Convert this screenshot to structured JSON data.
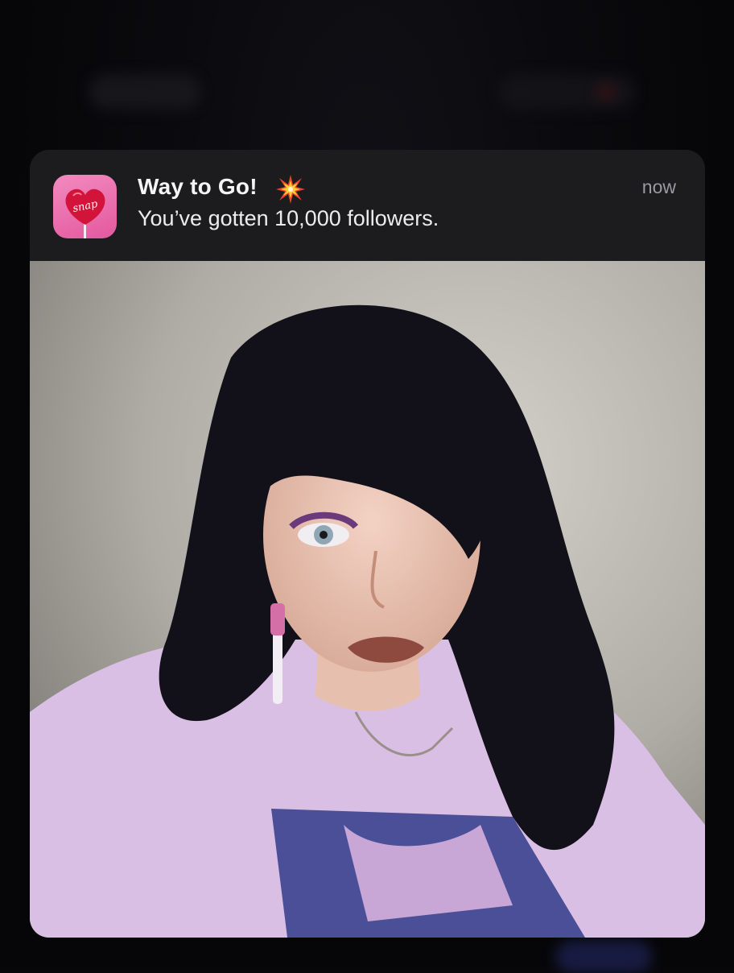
{
  "notification": {
    "app_icon": "snap-lollipop-heart-icon",
    "app_icon_text": "snap",
    "title": "Way to Go!",
    "title_emoji": "collision-emoji",
    "message": "You’ve gotten 10,000 followers.",
    "time": "now",
    "image": "selfie-photo"
  },
  "colors": {
    "card_bg": "#1c1c1f",
    "icon_pink": "#e3589f",
    "heart_red": "#d2143a"
  }
}
